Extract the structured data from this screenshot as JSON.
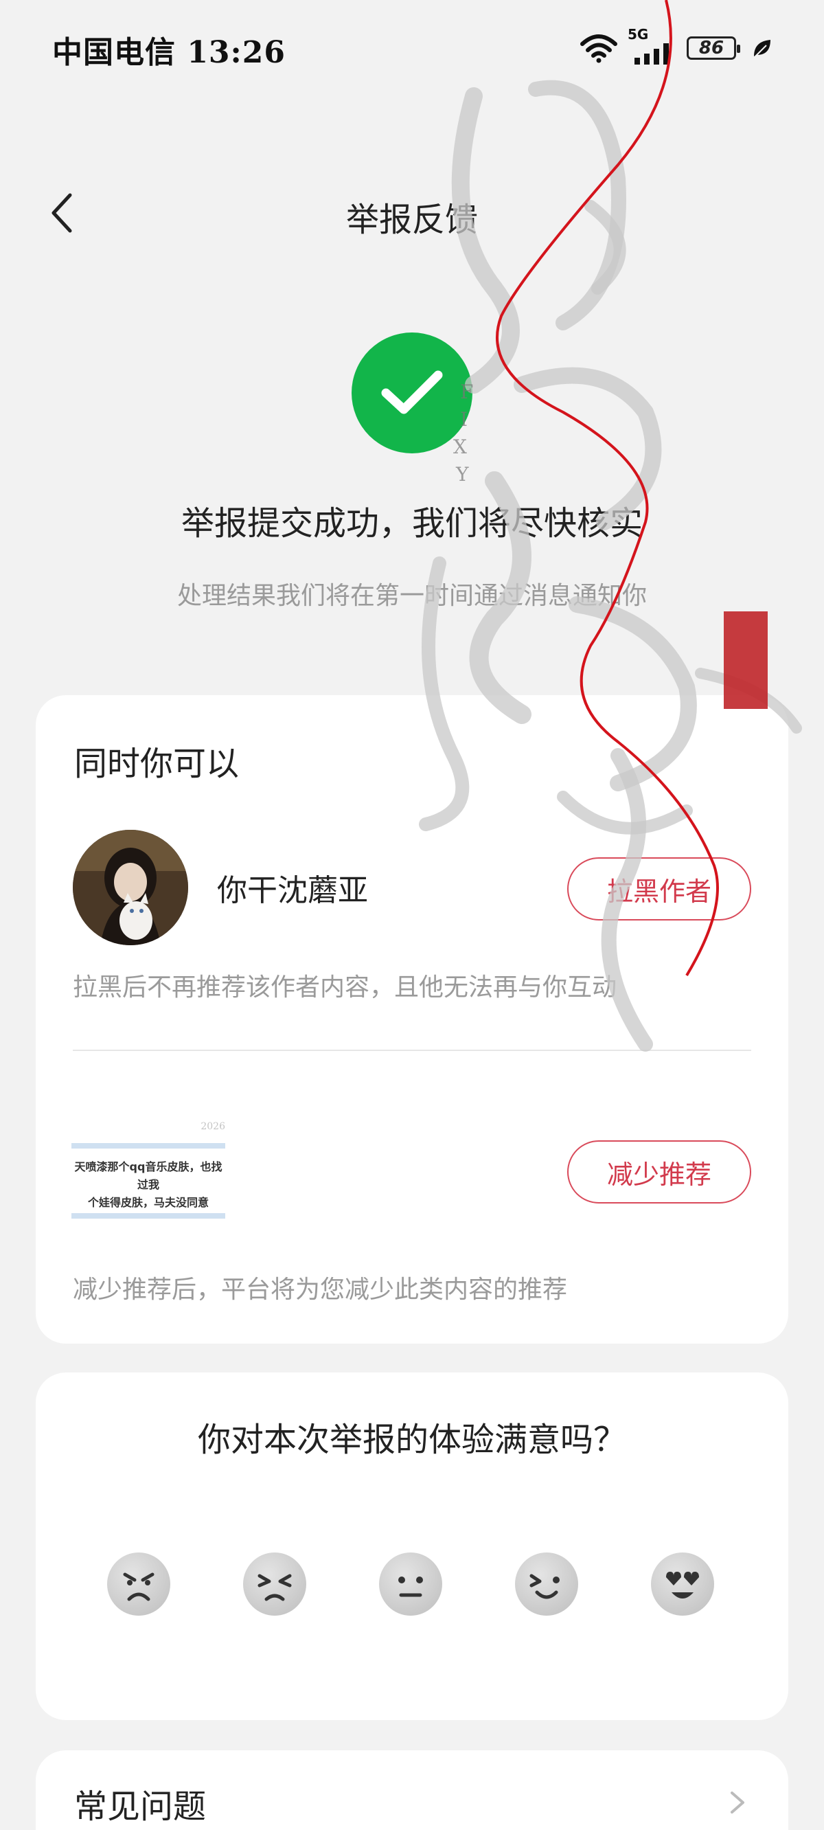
{
  "status_bar": {
    "carrier_time": "中国电信 13:26",
    "network": "5G",
    "battery": "86"
  },
  "nav": {
    "title": "举报反馈"
  },
  "result": {
    "title": "举报提交成功，我们将尽快核实",
    "subtitle": "处理结果我们将在第一时间通过消息通知你"
  },
  "actions": {
    "heading": "同时你可以",
    "author_name": "你干沈蘑亚",
    "block_button": "拉黑作者",
    "block_hint": "拉黑后不再推荐该作者内容，且他无法再与你互动",
    "thumbnail_date": "2026",
    "thumbnail_line1": "天喷漆那个qq音乐皮肤，也找过我",
    "thumbnail_line2": "个娃得皮肤，马夫没同意",
    "reduce_button": "减少推荐",
    "reduce_hint": "减少推荐后，平台将为您减少此类内容的推荐"
  },
  "survey": {
    "title": "你对本次举报的体验满意吗？",
    "options": [
      "angry-face-icon",
      "upset-face-icon",
      "neutral-face-icon",
      "smile-face-icon",
      "heart-eyes-face-icon"
    ]
  },
  "faq": {
    "title": "常见问题"
  },
  "colors": {
    "accent": "#d23a4c",
    "success": "#12b54a",
    "background": "#f2f2f2"
  }
}
